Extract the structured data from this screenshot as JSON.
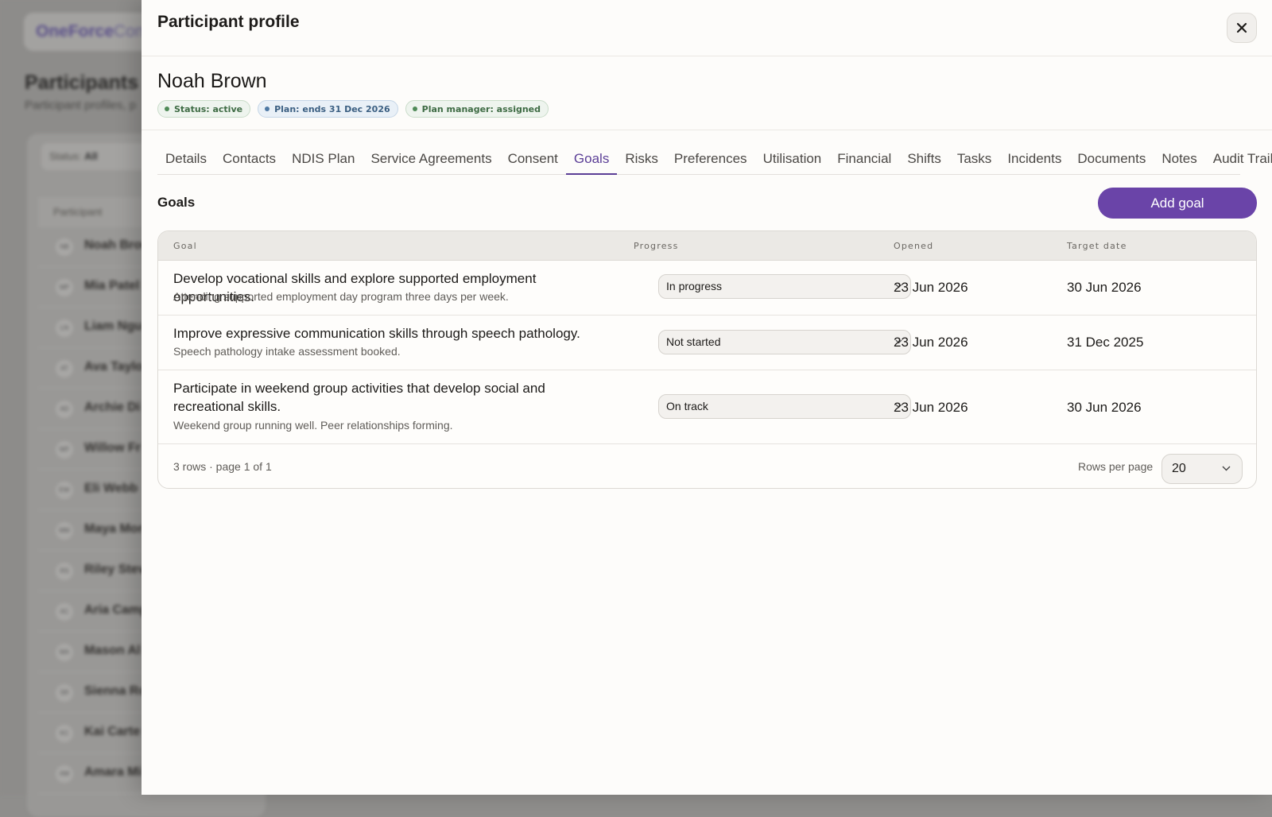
{
  "background": {
    "brand_part1": "OneForce",
    "brand_part2": "Con",
    "title": "Participants",
    "subtitle": "Participant profiles, p",
    "filter_label": "Status:",
    "filter_value": "All",
    "column_header": "Participant",
    "rows": [
      {
        "initials": "NB",
        "name": "Noah Brow"
      },
      {
        "initials": "MP",
        "name": "Mia Patel"
      },
      {
        "initials": "LN",
        "name": "Liam Ngu"
      },
      {
        "initials": "AT",
        "name": "Ava Taylo"
      },
      {
        "initials": "AD",
        "name": "Archie Di"
      },
      {
        "initials": "WF",
        "name": "Willow Fr"
      },
      {
        "initials": "EW",
        "name": "Eli Webb"
      },
      {
        "initials": "MM",
        "name": "Maya Mor"
      },
      {
        "initials": "RS",
        "name": "Riley Stev"
      },
      {
        "initials": "AC",
        "name": "Aria Camp"
      },
      {
        "initials": "MA",
        "name": "Mason Al"
      },
      {
        "initials": "SR",
        "name": "Sienna Ro"
      },
      {
        "initials": "KC",
        "name": "Kai Carte"
      },
      {
        "initials": "AM",
        "name": "Amara Mi"
      }
    ]
  },
  "drawer": {
    "title": "Participant profile",
    "participant_name": "Noah Brown",
    "badges": [
      {
        "text": "Status: active",
        "tone": "green"
      },
      {
        "text": "Plan: ends 31 Dec 2026",
        "tone": "blue"
      },
      {
        "text": "Plan manager: assigned",
        "tone": "green"
      }
    ],
    "tabs": [
      "Details",
      "Contacts",
      "NDIS Plan",
      "Service Agreements",
      "Consent",
      "Goals",
      "Risks",
      "Preferences",
      "Utilisation",
      "Financial",
      "Shifts",
      "Tasks",
      "Incidents",
      "Documents",
      "Notes",
      "Audit Trail"
    ],
    "active_tab": "Goals",
    "section_title": "Goals",
    "add_button": "Add goal",
    "table": {
      "headers": [
        "Goal",
        "Progress",
        "Opened",
        "Target date"
      ],
      "rows": [
        {
          "goal": "Develop vocational skills and explore supported employment opportunities.",
          "note": "Attending supported employment day program three days per week.",
          "progress": "In progress",
          "opened": "23 Jun 2026",
          "target": "30 Jun 2026"
        },
        {
          "goal": "Improve expressive communication skills through speech pathology.",
          "note": "Speech pathology intake assessment booked.",
          "progress": "Not started",
          "opened": "23 Jun 2026",
          "target": "31 Dec 2025"
        },
        {
          "goal": "Participate in weekend group activities that develop social and recreational skills.",
          "note": "Weekend group running well. Peer relationships forming.",
          "progress": "On track",
          "opened": "23 Jun 2026",
          "target": "30 Jun 2026"
        }
      ],
      "footer_info": "3 rows · page 1 of 1",
      "rows_per_page_label": "Rows per page",
      "rows_per_page_value": "20"
    }
  },
  "colors": {
    "accent": "#6a44a8",
    "active_tab": "#5b3e96",
    "status_green": "#4f8a57",
    "status_blue": "#4d78a3"
  },
  "icons": {
    "close": "close-icon",
    "dropdown": "chevron-down-icon"
  }
}
